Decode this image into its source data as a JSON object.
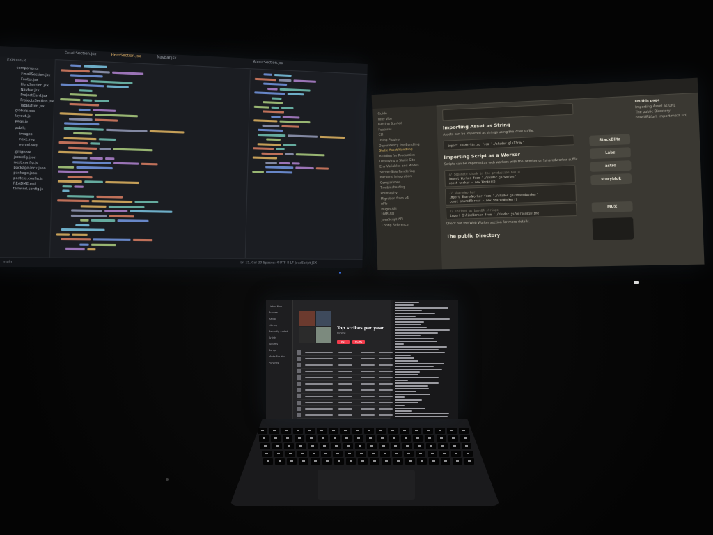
{
  "left_monitor": {
    "tabs": [
      "EmailSection.jsx",
      "HeroSection.jsx",
      "Navbar.jsx",
      "AboutSection.jsx"
    ],
    "explorer_title": "EXPLORER",
    "files": [
      "components",
      "EmailSection.jsx",
      "Footer.jsx",
      "HeroSection.jsx",
      "Navbar.jsx",
      "ProjectCard.jsx",
      "ProjectsSection.jsx",
      "TabButton.jsx",
      "globals.css",
      "layout.js",
      "page.js",
      "public",
      "images",
      "next.svg",
      "vercel.svg",
      ".gitignore",
      "jsconfig.json",
      "next.config.js",
      "package-lock.json",
      "package.json",
      "postcss.config.js",
      "README.md",
      "tailwind.config.js"
    ],
    "status_left": "main",
    "status_right": "Ln 15, Col 20  Spaces: 4  UTF-8  LF  JavaScript JSX"
  },
  "right_monitor": {
    "nav_items": [
      "Guide",
      "Why Vite",
      "Getting Started",
      "Features",
      "CLI",
      "Using Plugins",
      "Dependency Pre-Bundling",
      "Static Asset Handling",
      "Building for Production",
      "Deploying a Static Site",
      "Env Variables and Modes",
      "Server-Side Rendering",
      "Backend Integration",
      "Comparisons",
      "Troubleshooting",
      "Philosophy",
      "Migration from v4",
      "APIs",
      "Plugin API",
      "HMR API",
      "JavaScript API",
      "Config Reference"
    ],
    "heading_1": "Importing Asset as String",
    "para_1": "Assets can be imported as strings using the ?raw suffix.",
    "code_1": "import shaderString from './shader.glsl?raw'",
    "heading_2": "Importing Script as a Worker",
    "para_2": "Scripts can be imported as web workers with the ?worker or ?sharedworker suffix.",
    "code_2": [
      "// Separate chunk in the production build",
      "import Worker from './shader.js?worker'",
      "const worker = new Worker()"
    ],
    "code_3": [
      "// sharedworker",
      "import SharedWorker from './shader.js?sharedworker'",
      "const sharedWorker = new SharedWorker()"
    ],
    "code_4": [
      "// Inlined as base64 strings",
      "import InlineWorker from './shader.js?worker&inline'"
    ],
    "para_3": "Check out the Web Worker section for more details.",
    "heading_3": "The public Directory",
    "toc_title": "On this page",
    "toc_items": [
      "Importing Asset as URL",
      "The public Directory",
      "new URL(url, import.meta.url)"
    ],
    "sponsors": [
      "StackBlitz",
      "Labs",
      "astro",
      "storyblok",
      "MUX"
    ]
  },
  "laptop": {
    "playlist_title": "Top strikes per year",
    "playlist_sub": "Playlist",
    "play_label": "Play",
    "shuffle_label": "Shuffle",
    "sidebar": [
      "Listen Now",
      "Browse",
      "Radio",
      "Library",
      "Recently Added",
      "Artists",
      "Albums",
      "Songs",
      "Made For You",
      "Playlists"
    ]
  }
}
